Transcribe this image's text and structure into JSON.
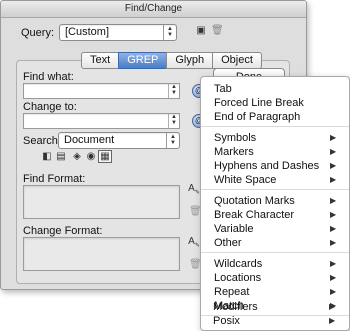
{
  "window": {
    "title": "Find/Change"
  },
  "query": {
    "label": "Query:",
    "value": "[Custom]"
  },
  "tabs": [
    {
      "label": "Text",
      "active": false
    },
    {
      "label": "GREP",
      "active": true
    },
    {
      "label": "Glyph",
      "active": false
    },
    {
      "label": "Object",
      "active": false
    }
  ],
  "find": {
    "label": "Find what:",
    "value": ""
  },
  "change": {
    "label": "Change to:",
    "value": ""
  },
  "search": {
    "label": "Search:",
    "value": "Document"
  },
  "find_format": {
    "label": "Find Format:"
  },
  "change_format": {
    "label": "Change Format:"
  },
  "buttons": {
    "done": "Done"
  },
  "menu": {
    "group1": [
      "Tab",
      "Forced Line Break",
      "End of Paragraph"
    ],
    "group2": [
      "Symbols",
      "Markers",
      "Hyphens and Dashes",
      "White Space"
    ],
    "group3": [
      "Quotation Marks",
      "Break Character",
      "Variable",
      "Other"
    ],
    "group4": [
      "Wildcards",
      "Locations",
      "Repeat",
      "Match"
    ],
    "group5": [
      "Modifiers",
      "Posix"
    ]
  }
}
